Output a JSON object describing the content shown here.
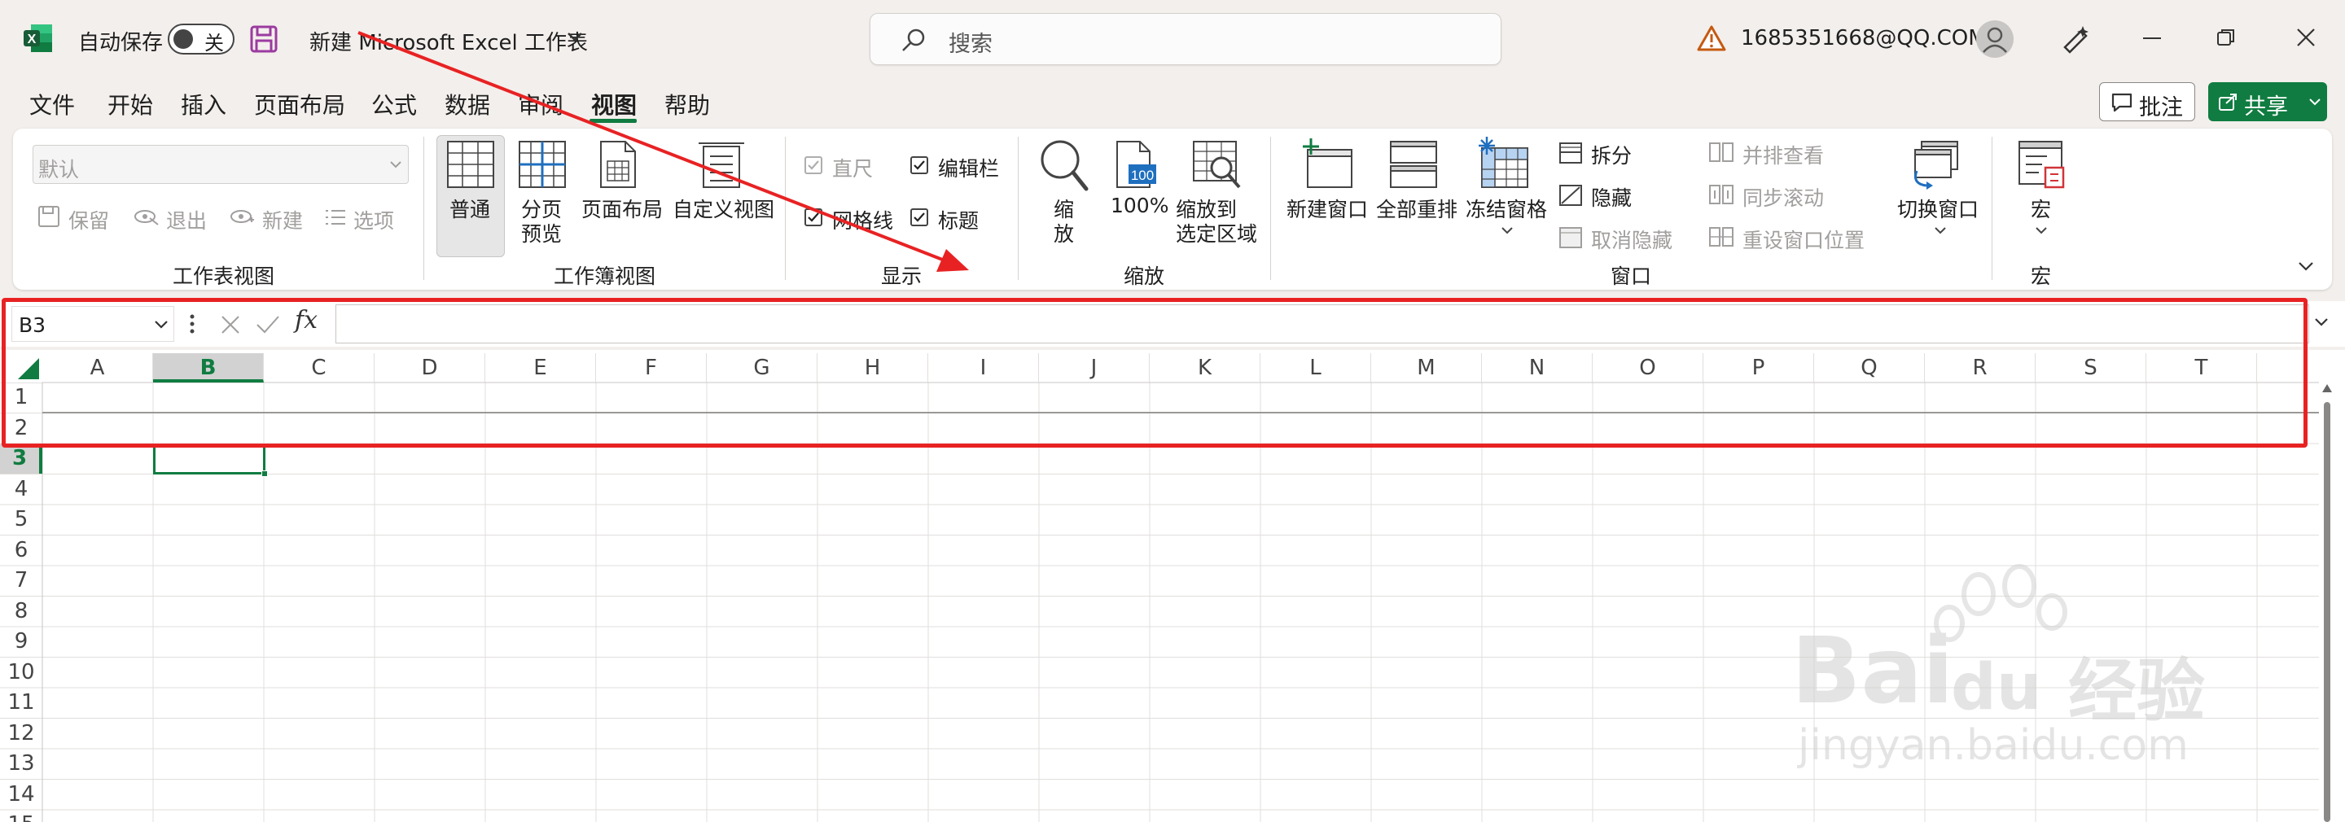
{
  "titlebar": {
    "autosave_label": "自动保存",
    "autosave_state": "关",
    "doc_title": "新建 Microsoft Excel 工作表",
    "search_placeholder": "搜索",
    "account": "1685351668@QQ.COM"
  },
  "menu": {
    "items": [
      "文件",
      "开始",
      "插入",
      "页面布局",
      "公式",
      "数据",
      "审阅",
      "视图",
      "帮助"
    ],
    "active_index": 7,
    "comment_label": "批注",
    "share_label": "共享"
  },
  "ribbon": {
    "sheet_view": {
      "combo_value": "默认",
      "keep": "保留",
      "exit": "退出",
      "new": "新建",
      "options": "选项",
      "label": "工作表视图"
    },
    "workbook_view": {
      "normal": "普通",
      "page_break_1": "分页",
      "page_break_2": "预览",
      "page_layout": "页面布局",
      "custom_view": "自定义视图",
      "label": "工作簿视图"
    },
    "show": {
      "ruler": "直尺",
      "formula_bar": "编辑栏",
      "gridlines": "网格线",
      "headings": "标题",
      "label": "显示"
    },
    "zoom": {
      "zoom_1": "缩",
      "zoom_2": "放",
      "hundred": "100%",
      "sel_1": "缩放到",
      "sel_2": "选定区域",
      "label": "缩放",
      "icon_badge": "100"
    },
    "window": {
      "new_window": "新建窗口",
      "arrange_all": "全部重排",
      "freeze": "冻结窗格",
      "split": "拆分",
      "hide": "隐藏",
      "unhide": "取消隐藏",
      "side_by_side": "并排查看",
      "sync_scroll": "同步滚动",
      "reset_pos": "重设窗口位置",
      "switch": "切换窗口",
      "label": "窗口"
    },
    "macros": {
      "macro": "宏",
      "label": "宏"
    }
  },
  "formula": {
    "name_box": "B3",
    "fx": "fx"
  },
  "grid": {
    "columns": [
      "A",
      "B",
      "C",
      "D",
      "E",
      "F",
      "G",
      "H",
      "I",
      "J",
      "K",
      "L",
      "M",
      "N",
      "O",
      "P",
      "Q",
      "R",
      "S",
      "T"
    ],
    "selected_column": "B",
    "rows": [
      "1",
      "2",
      "3",
      "4",
      "5",
      "6",
      "7",
      "8",
      "9",
      "10",
      "11",
      "12",
      "13",
      "14",
      "15"
    ],
    "selected_row": "3"
  },
  "watermark": {
    "line1": "Bai",
    "line1b": "du",
    "line1c": "经验",
    "line2": "jingyan.baidu.com"
  },
  "colors": {
    "accent": "#107c41",
    "annotation": "#e82223"
  }
}
